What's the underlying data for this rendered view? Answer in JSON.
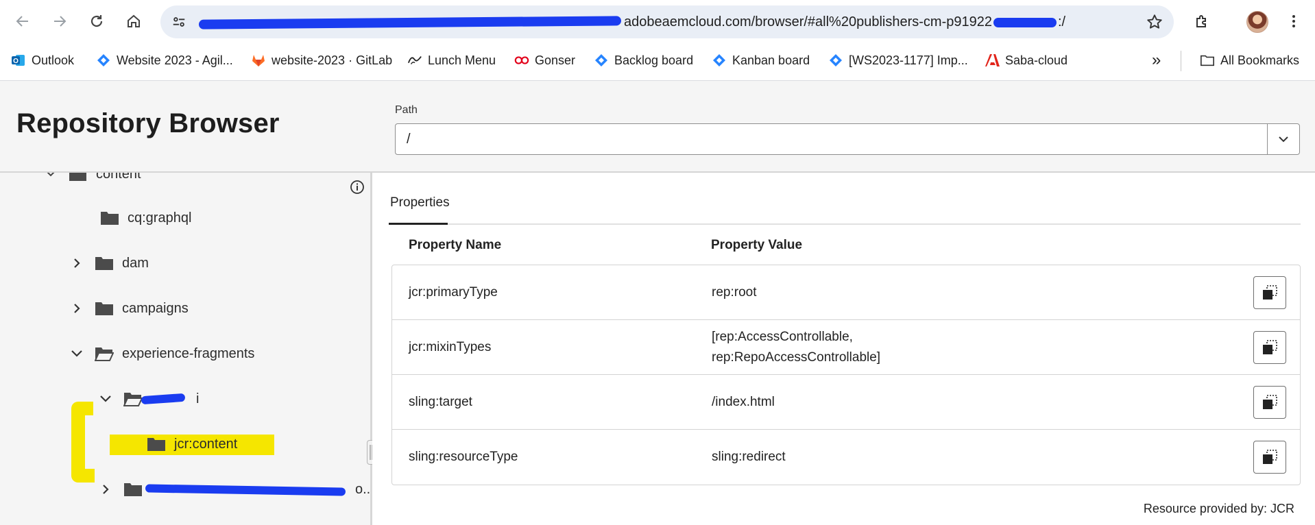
{
  "browser": {
    "url_visible_part": "adobeaemcloud.com/browser/#all%20publishers-cm-p91922",
    "url_end": ":/",
    "bookmarks": [
      {
        "label": "Outlook",
        "icon": "outlook-icon"
      },
      {
        "label": "Website 2023 - Agil...",
        "icon": "jira-icon"
      },
      {
        "label": "website-2023 · GitLab",
        "icon": "gitlab-icon"
      },
      {
        "label": "Lunch Menu",
        "icon": "lunch-menu-icon"
      },
      {
        "label": "Gonser",
        "icon": "gonser-icon"
      },
      {
        "label": "Backlog board",
        "icon": "jira-icon"
      },
      {
        "label": "Kanban board",
        "icon": "jira-icon"
      },
      {
        "label": "[WS2023-1177] Imp...",
        "icon": "jira-icon"
      },
      {
        "label": "Saba-cloud",
        "icon": "adobe-icon"
      }
    ],
    "all_bookmarks_label": "All Bookmarks",
    "overflow_label": "»"
  },
  "app": {
    "title": "Repository Browser",
    "path_label": "Path",
    "path_value": "/"
  },
  "tree": {
    "top_item": "content",
    "items": [
      {
        "label": "cq:graphql",
        "expand": "none"
      },
      {
        "label": "dam",
        "expand": "collapsed"
      },
      {
        "label": "campaigns",
        "expand": "collapsed"
      },
      {
        "label": "experience-fragments",
        "expand": "expanded"
      },
      {
        "label": "i",
        "expand": "expanded"
      },
      {
        "label": "jcr:content",
        "expand": "none"
      },
      {
        "label": "",
        "expand": "collapsed"
      }
    ],
    "truncated_suffix": "o..."
  },
  "properties": {
    "tab_label": "Properties",
    "col_name": "Property Name",
    "col_value": "Property Value",
    "rows": [
      {
        "name": "jcr:primaryType",
        "value": "rep:root"
      },
      {
        "name": "jcr:mixinTypes",
        "value": "[rep:AccessControllable,",
        "value2": "rep:RepoAccessControllable]"
      },
      {
        "name": "sling:target",
        "value": "/index.html"
      },
      {
        "name": "sling:resourceType",
        "value": "sling:redirect"
      }
    ],
    "footer": "Resource provided by: JCR"
  },
  "colors": {
    "highlight": "#f5e600",
    "redaction": "#1a3cf0",
    "header_bg": "#f5f5f5"
  }
}
